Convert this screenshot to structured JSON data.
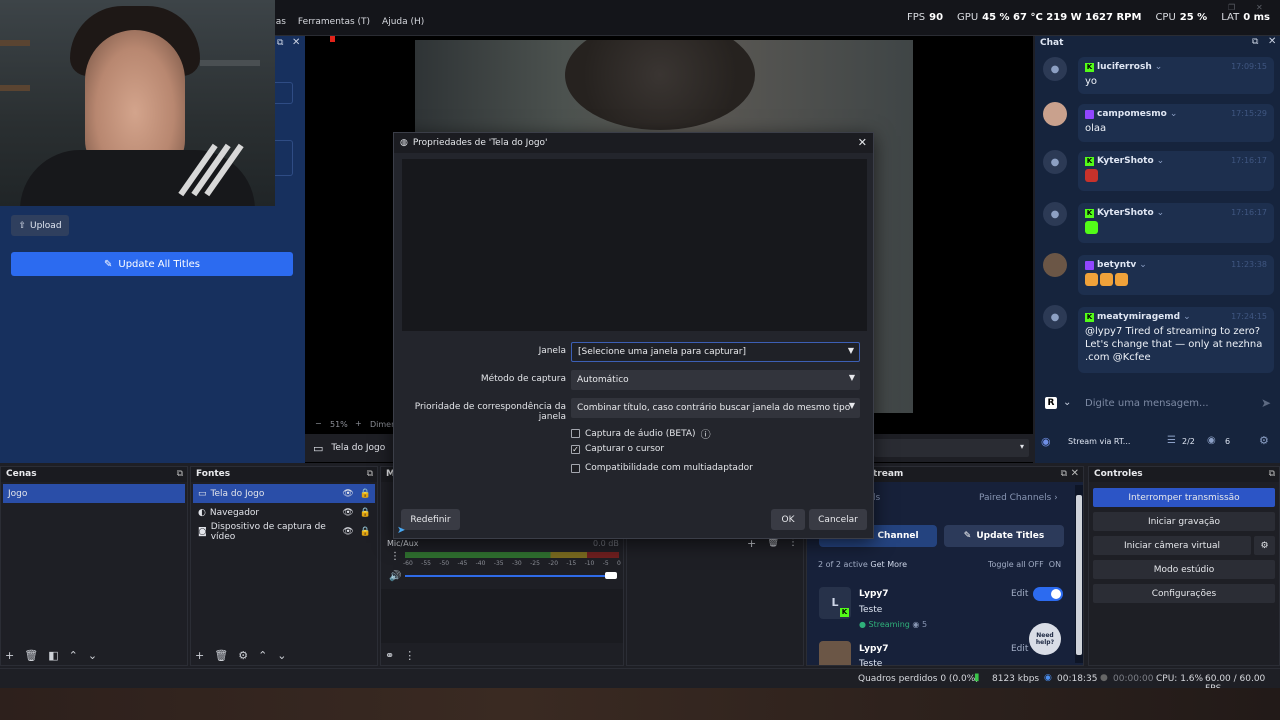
{
  "menu": [
    "nas",
    "Ferramentas (T)",
    "Ajuda (H)"
  ],
  "stats": {
    "fps_label": "FPS",
    "fps": "90",
    "gpu_label": "GPU",
    "gpu": "45 % 67 °C 219 W 1627 RPM",
    "cpu_label": "CPU",
    "cpu": "25 %",
    "lat_label": "LAT",
    "lat": "0 ms"
  },
  "left_panel": {
    "upload": "Upload",
    "update_all": "Update All Titles"
  },
  "preview": {
    "zoom": "51%",
    "dim": "Dimen",
    "source_name": "Tela do Jogo"
  },
  "chat": {
    "title": "Chat",
    "messages": [
      {
        "user": "luciferrosh",
        "time": "17:09:15",
        "text": "yo",
        "platform": "kick"
      },
      {
        "user": "campomesmo",
        "time": "17:15:29",
        "text": "olaa",
        "platform": "twitch"
      },
      {
        "user": "KyterShoto",
        "time": "17:16:17",
        "text": "",
        "platform": "kick"
      },
      {
        "user": "KyterShoto",
        "time": "17:16:17",
        "text": "",
        "platform": "kick"
      },
      {
        "user": "betyntv",
        "time": "11:23:38",
        "text": "",
        "platform": "twitch"
      },
      {
        "user": "meatymiragemd",
        "time": "17:24:15",
        "text": "@lypy7 Tired of streaming to zero? Let's change that — only at nezhna .com @Kcfee",
        "platform": "kick"
      }
    ],
    "input_placeholder": "Digite uma mensagem...",
    "footer_label": "Stream via RT...",
    "viewers_ratio": "2/2",
    "viewers": "6"
  },
  "dialog": {
    "title": "Propriedades de 'Tela do Jogo'",
    "janela_label": "Janela",
    "janela_value": "[Selecione uma janela para capturar]",
    "metodo_label": "Método de captura",
    "metodo_value": "Automático",
    "prioridade_label": "Prioridade de correspondência da janela",
    "prioridade_value": "Combinar título, caso contrário buscar janela do mesmo tipo",
    "chk_audio": "Captura de áudio (BETA)",
    "chk_cursor": "Capturar o cursor",
    "chk_multi": "Compatibilidade com multiadaptador",
    "redefinir": "Redefinir",
    "ok": "OK",
    "cancelar": "Cancelar"
  },
  "scenes": {
    "title": "Cenas",
    "items": [
      "Jogo"
    ]
  },
  "sources": {
    "title": "Fontes",
    "items": [
      "Tela do Jogo",
      "Navegador",
      "Dispositivo de captura de vídeo"
    ]
  },
  "mixer": {
    "header": "M",
    "channel": "Mic/Aux",
    "db": "0.0 dB",
    "ticks": [
      "-60",
      "-55",
      "-50",
      "-45",
      "-40",
      "-35",
      "-30",
      "-25",
      "-20",
      "-15",
      "-10",
      "-5",
      "0"
    ]
  },
  "multistream": {
    "title": "tream",
    "tab": "ls",
    "paired": "Paired Channels",
    "add_channel": "Channel",
    "update_titles": "Update Titles",
    "active": "2 of 2 active",
    "get_more": "Get More",
    "toggle_all": "Toggle all",
    "off": "OFF",
    "on": "ON",
    "channels": [
      {
        "name": "Lypy7",
        "title": "Teste",
        "status": "Streaming",
        "viewers": "5",
        "edit": "Edit",
        "avatar": "L"
      },
      {
        "name": "Lypy7",
        "title": "Teste",
        "edit": "Edit"
      }
    ],
    "help": "Need help?"
  },
  "controls": {
    "title": "Controles",
    "buttons": [
      "Interromper transmissão",
      "Iniciar gravação",
      "Iniciar câmera virtual",
      "Modo estúdio",
      "Configurações"
    ]
  },
  "status": {
    "frames": "Quadros perdidos 0 (0.0%)",
    "kbps": "8123 kbps",
    "stream_time": "00:18:35",
    "rec_time": "00:00:00",
    "cpu": "CPU: 1.6%",
    "fps": "60.00 / 60.00 FPS"
  },
  "colors": {
    "accent": "#2c6bf0",
    "selected": "#2a4ea8",
    "kick": "#53fc18",
    "twitch": "#9146ff"
  }
}
